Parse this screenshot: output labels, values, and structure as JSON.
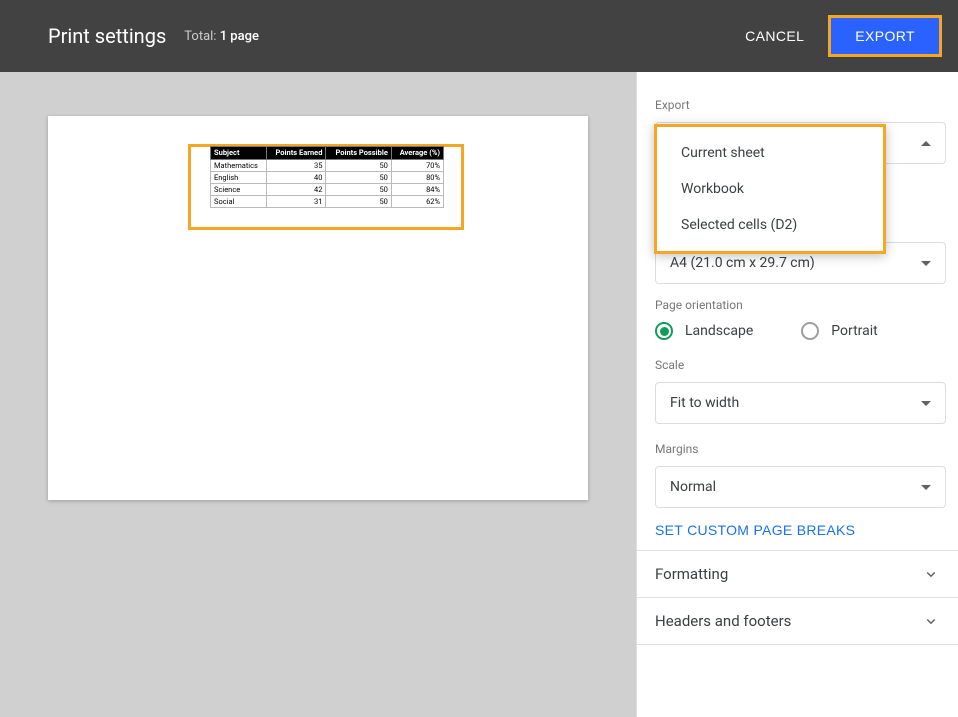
{
  "header": {
    "title": "Print settings",
    "total_prefix": "Total: ",
    "total_value": "1 page",
    "cancel": "CANCEL",
    "export": "EXPORT"
  },
  "preview_table": {
    "headers": [
      "Subject",
      "Points Earned",
      "Points Possible",
      "Average (%)"
    ],
    "rows": [
      [
        "Mathematics",
        "35",
        "50",
        "70%"
      ],
      [
        "English",
        "40",
        "50",
        "80%"
      ],
      [
        "Science",
        "42",
        "50",
        "84%"
      ],
      [
        "Social",
        "31",
        "50",
        "62%"
      ]
    ]
  },
  "side": {
    "export_label": "Export",
    "export_options": [
      "Current sheet",
      "Workbook",
      "Selected cells (D2)"
    ],
    "paper_value": "A4 (21.0 cm x 29.7 cm)",
    "orientation_label": "Page orientation",
    "orientation": {
      "landscape": "Landscape",
      "portrait": "Portrait"
    },
    "scale_label": "Scale",
    "scale_value": "Fit to width",
    "margins_label": "Margins",
    "margins_value": "Normal",
    "page_breaks": "SET CUSTOM PAGE BREAKS",
    "formatting": "Formatting",
    "headers_footers": "Headers and footers"
  }
}
